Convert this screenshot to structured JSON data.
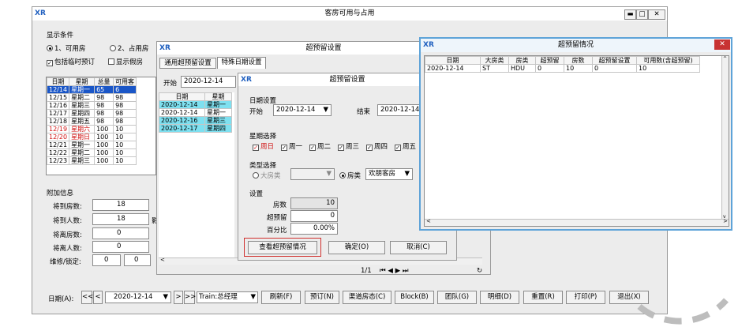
{
  "main": {
    "title": "客房可用与占用",
    "display_group": "显示条件",
    "radio1": "1、可用房",
    "radio2": "2、占用房",
    "chk_temp": "包括临时预订",
    "chk_fake": "显示假房",
    "grid_headers": [
      "日期",
      "星期",
      "总量",
      "可用客"
    ],
    "grid_rows": [
      [
        "12/14",
        "星期一",
        "65",
        "6"
      ],
      [
        "12/15",
        "星期二",
        "98",
        "98"
      ],
      [
        "12/16",
        "星期三",
        "98",
        "98"
      ],
      [
        "12/17",
        "星期四",
        "98",
        "98"
      ],
      [
        "12/18",
        "星期五",
        "98",
        "98"
      ],
      [
        "12/19",
        "星期六",
        "100",
        "10"
      ],
      [
        "12/20",
        "星期日",
        "100",
        "10"
      ],
      [
        "12/21",
        "星期一",
        "100",
        "10"
      ],
      [
        "12/22",
        "星期二",
        "100",
        "10"
      ],
      [
        "12/23",
        "星期三",
        "100",
        "10"
      ]
    ],
    "extra_group": "附加信息",
    "info_labels": [
      "将到房数:",
      "将到人数:",
      "将离房数:",
      "将离人数:",
      "维修/锁定:"
    ],
    "info_values": [
      "18",
      "18",
      "0",
      "0",
      "0"
    ],
    "info_value2": "0",
    "info_side": "影",
    "date_label": "日期(A):",
    "date_value": "2020-12-14",
    "nav_prev2": "<<",
    "nav_prev": "<",
    "nav_next": ">",
    "nav_next2": ">>",
    "train": "Train:总经理",
    "buttons": [
      "刷新(F)",
      "预订(N)",
      "渠道房态(C)",
      "Block(B)",
      "团队(G)",
      "明细(D)",
      "重置(R)",
      "打印(P)",
      "退出(X)"
    ]
  },
  "over_settings": {
    "title": "超预留设置",
    "tab1": "通用超预留设置",
    "tab2": "特殊日期设置",
    "start_label": "开始",
    "start_value": "2020-12-14",
    "grid_headers": [
      "日期",
      "星期"
    ],
    "grid_rows": [
      [
        "2020-12-14",
        "星期一"
      ],
      [
        "2020-12-14",
        "星期一"
      ],
      [
        "2020-12-16",
        "星期三"
      ],
      [
        "2020-12-17",
        "星期四"
      ]
    ],
    "pager": "1/1"
  },
  "inner_dialog": {
    "title": "超预留设置",
    "date_group": "日期设置",
    "start_label": "开始",
    "start_value": "2020-12-14",
    "end_label": "结束",
    "end_value": "2020-12-14",
    "week_group": "星期选择",
    "weekdays": [
      "周日",
      "周一",
      "周二",
      "周三",
      "周四",
      "周五"
    ],
    "type_group": "类型选择",
    "type_big": "大房类",
    "type_room": "房类",
    "room_value": "欢朋客房",
    "settings_group": "设置",
    "room_count_label": "房数",
    "room_count": "10",
    "over_label": "超预留",
    "over_value": "0",
    "pct_label": "百分比",
    "pct_value": "0.00%",
    "btn_view": "查看超预留情况",
    "btn_ok": "确定(O)",
    "btn_cancel": "取消(C)"
  },
  "status_win": {
    "title": "超预留情况",
    "headers": [
      "日期",
      "大房类",
      "房类",
      "超预留",
      "房数",
      "超预留设置",
      "可用数(含超预留)"
    ],
    "row": [
      "2020-12-14",
      "ST",
      "HDU",
      "0",
      "10",
      "0",
      "10"
    ]
  },
  "colors": {
    "accent": "#1a56c7",
    "highlight": "#7ee0f0",
    "weekend": "#d01010",
    "close": "#c83232",
    "emphasis": "#d0302e"
  }
}
